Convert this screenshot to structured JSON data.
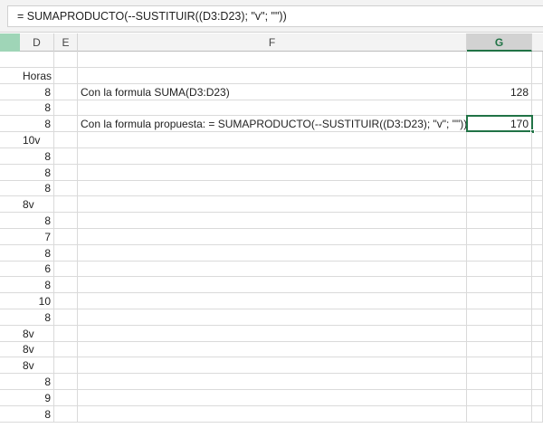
{
  "formula_bar": {
    "value": "= SUMAPRODUCTO(--SUSTITUIR((D3:D23); \"v\"; \"\"))"
  },
  "columns": [
    "D",
    "E",
    "F",
    "G"
  ],
  "selected_column": "G",
  "rows": [
    {
      "d": "",
      "f": "",
      "g": ""
    },
    {
      "d": "Horas",
      "f": "",
      "g": ""
    },
    {
      "d": "8",
      "f": "Con la formula SUMA(D3:D23)",
      "g": "128"
    },
    {
      "d": "8",
      "f": "",
      "g": ""
    },
    {
      "d": "8",
      "f": "Con la formula propuesta: = SUMAPRODUCTO(--SUSTITUIR((D3:D23); \"v\"; \"\"))",
      "g": "170"
    },
    {
      "d": "10v",
      "f": "",
      "g": ""
    },
    {
      "d": "8",
      "f": "",
      "g": ""
    },
    {
      "d": "8",
      "f": "",
      "g": ""
    },
    {
      "d": "8",
      "f": "",
      "g": ""
    },
    {
      "d": "8v",
      "f": "",
      "g": ""
    },
    {
      "d": "8",
      "f": "",
      "g": ""
    },
    {
      "d": "7",
      "f": "",
      "g": ""
    },
    {
      "d": "8",
      "f": "",
      "g": ""
    },
    {
      "d": "6",
      "f": "",
      "g": ""
    },
    {
      "d": "8",
      "f": "",
      "g": ""
    },
    {
      "d": "10",
      "f": "",
      "g": ""
    },
    {
      "d": "8",
      "f": "",
      "g": ""
    },
    {
      "d": "8v",
      "f": "",
      "g": ""
    },
    {
      "d": "8v",
      "f": "",
      "g": ""
    },
    {
      "d": "8v",
      "f": "",
      "g": ""
    },
    {
      "d": "8",
      "f": "",
      "g": ""
    },
    {
      "d": "9",
      "f": "",
      "g": ""
    },
    {
      "d": "8",
      "f": "",
      "g": ""
    }
  ],
  "selected_row_index": 4,
  "accent": "#217346"
}
